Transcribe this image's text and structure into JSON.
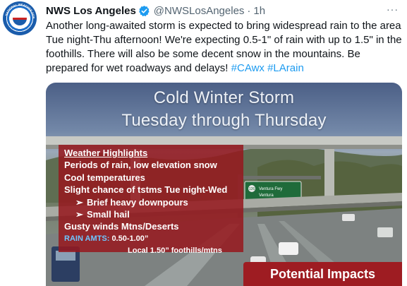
{
  "tweet": {
    "display_name": "NWS Los Angeles",
    "handle": "@NWSLosAngeles",
    "separator": "·",
    "time": "1h",
    "more_icon": "···",
    "avatar_ring_text": "NATIONAL WEATHER SERVICE",
    "text_main": "Another long-awaited storm is expected to bring widespread rain to the area Tue night-Thu afternoon! We're expecting 0.5-1\" of rain with up to 1.5\" in the foothills. There will also be some decent snow in the mountains. Be prepared for wet roadways and delays! ",
    "hashtag_1": "#CAwx",
    "hashtag_2": "#LArain"
  },
  "graphic": {
    "headline_1": "Cold Winter Storm",
    "headline_2": "Tuesday through Thursday",
    "highlights": {
      "title": "Weather Highlights",
      "items": [
        "Periods of rain, low elevation snow",
        "Cool temperatures",
        "Slight chance of tstms Tue night-Wed"
      ],
      "sub_items": [
        "Brief heavy downpours",
        "Small hail"
      ],
      "sub_marker": "➢",
      "winds": "Gusty winds Mtns/Deserts",
      "rain_label": "RAIN AMTS:",
      "rain_value_1": "0.50-1.00”",
      "rain_value_2": "Local 1.50” foothills/mtns"
    },
    "road_sign_route": "126",
    "road_sign_text_1": "Ventura Fwy",
    "road_sign_text_2": "Ventura",
    "impacts_label": "Potential Impacts"
  },
  "colors": {
    "link": "#1d9bf0",
    "text": "#0f1419",
    "secondary": "#536471",
    "verified": "#1d9bf0",
    "highlight_box": "#96191e",
    "impacts_box": "#9e1c22",
    "rain_label": "#6ec6ff"
  },
  "icons": {
    "avatar": "nws-logo-icon",
    "verified": "verified-badge-icon",
    "more": "more-options-icon"
  }
}
